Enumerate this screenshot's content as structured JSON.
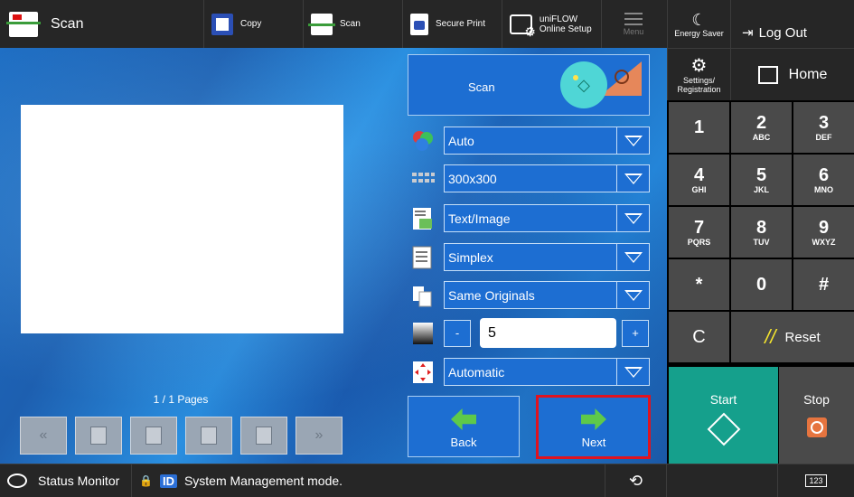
{
  "topbar": {
    "app_title": "Scan",
    "buttons": [
      {
        "label": "Copy",
        "icon": "copy-icon"
      },
      {
        "label": "Scan",
        "icon": "scan-icon"
      },
      {
        "label": "Secure Print",
        "icon": "lock-icon"
      },
      {
        "label": "uniFLOW Online Setup",
        "icon": "uniflow-setup-icon"
      }
    ],
    "menu_label": "Menu"
  },
  "preview": {
    "page_count": "1 / 1 Pages"
  },
  "scan_button": {
    "label": "Scan"
  },
  "settings": {
    "color_mode": "Auto",
    "resolution": "300x300",
    "original_type": "Text/Image",
    "sides": "Simplex",
    "originals": "Same Originals",
    "density": {
      "minus": "-",
      "value": "5",
      "plus": "+"
    },
    "orientation": "Automatic"
  },
  "nav": {
    "back": "Back",
    "next": "Next"
  },
  "right_panel": {
    "energy_saver": "Energy Saver",
    "log_out": "Log Out",
    "settings": "Settings/ Registration",
    "home": "Home",
    "keys": [
      {
        "n": "1",
        "l": ""
      },
      {
        "n": "2",
        "l": "ABC"
      },
      {
        "n": "3",
        "l": "DEF"
      },
      {
        "n": "4",
        "l": "GHI"
      },
      {
        "n": "5",
        "l": "JKL"
      },
      {
        "n": "6",
        "l": "MNO"
      },
      {
        "n": "7",
        "l": "PQRS"
      },
      {
        "n": "8",
        "l": "TUV"
      },
      {
        "n": "9",
        "l": "WXYZ"
      },
      {
        "n": "*",
        "l": ""
      },
      {
        "n": "0",
        "l": ""
      },
      {
        "n": "#",
        "l": ""
      }
    ],
    "clear": "C",
    "reset": "Reset",
    "start": "Start",
    "stop": "Stop"
  },
  "statusbar": {
    "status_monitor": "Status Monitor",
    "id_badge": "ID",
    "message": "System Management mode.",
    "keyboard": "123"
  },
  "colors": {
    "accent": "#1d6ed2",
    "start": "#15a08c",
    "highlight": "#e0131f",
    "stop": "#e6743f"
  }
}
